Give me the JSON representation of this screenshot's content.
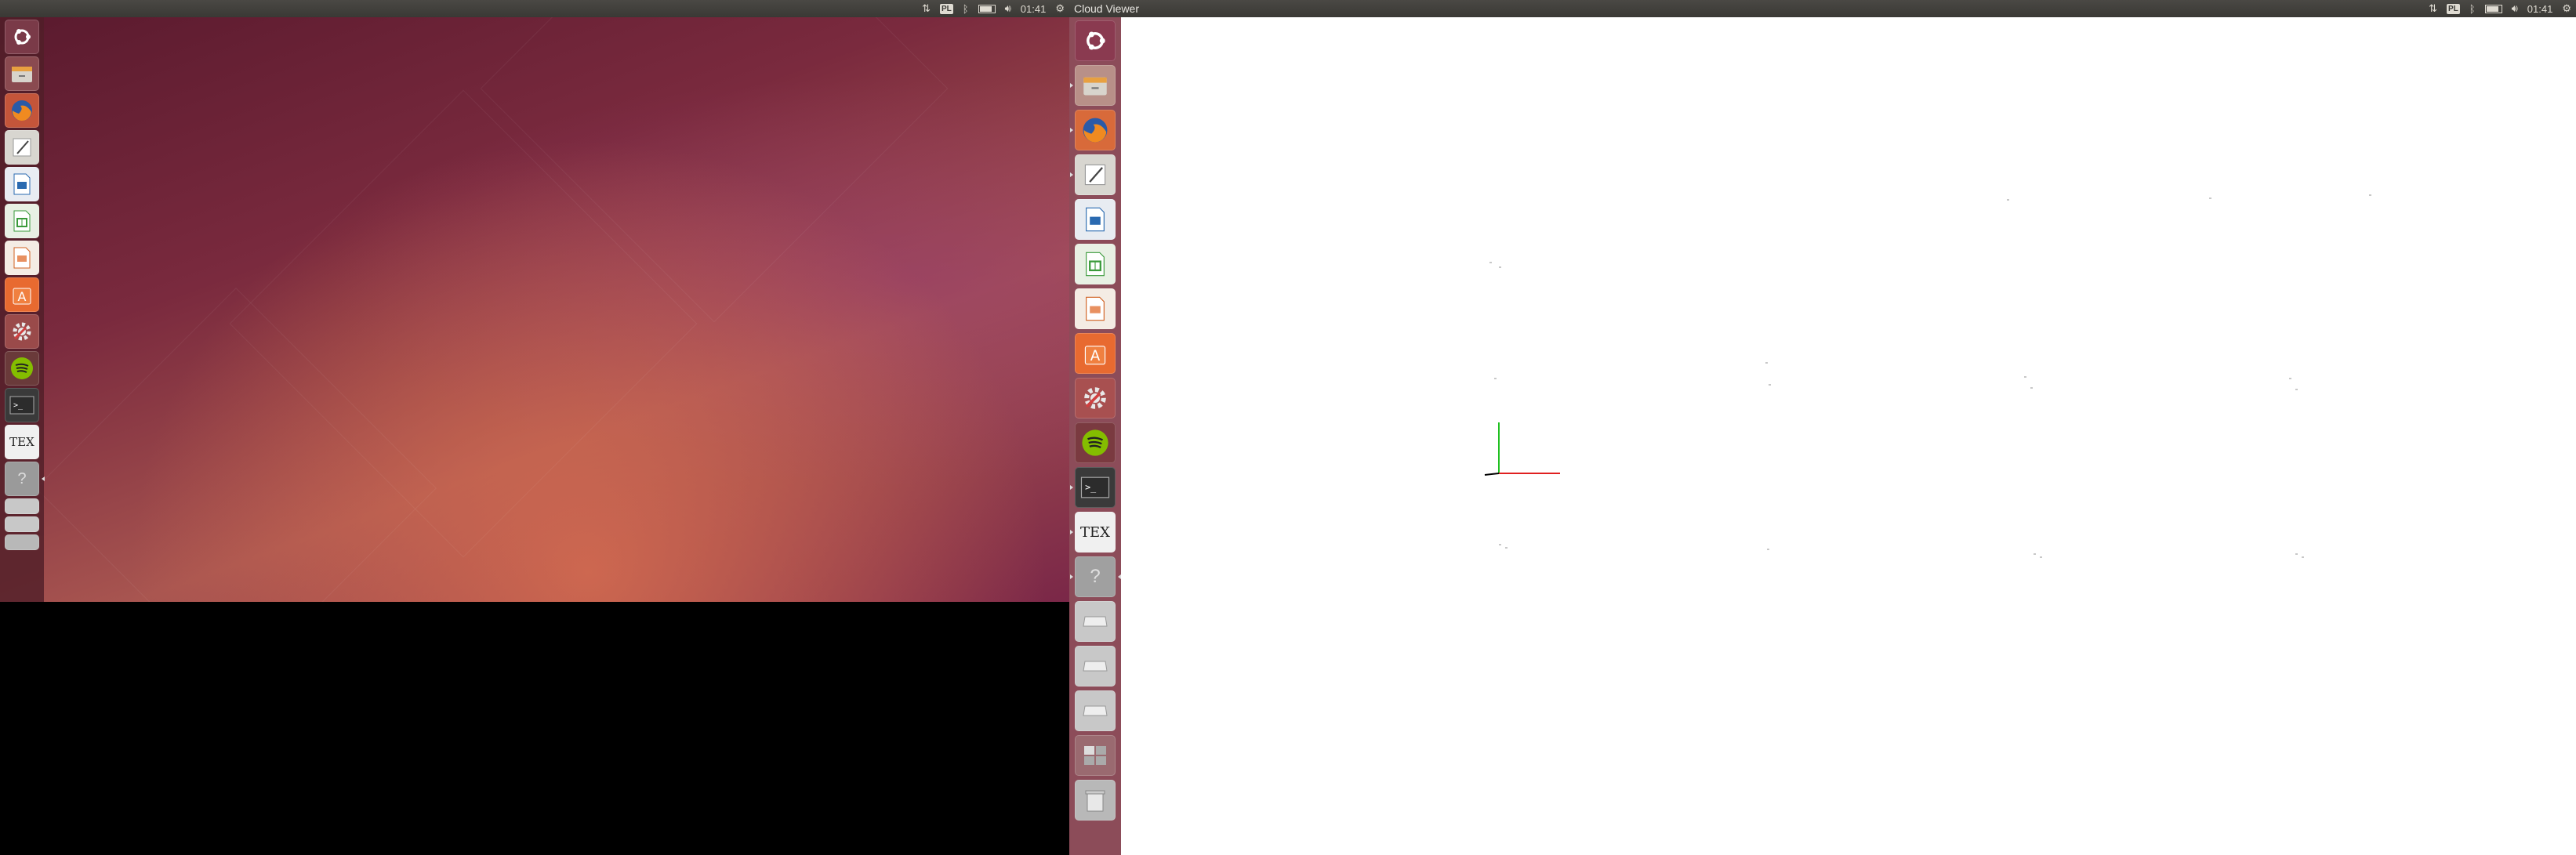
{
  "left_screen": {
    "panel": {
      "keyboard_layout": "PL",
      "clock": "01:41"
    }
  },
  "right_screen": {
    "window_title": "Cloud Viewer",
    "panel": {
      "keyboard_layout": "PL",
      "clock": "01:41"
    }
  },
  "launcher_items": [
    {
      "name": "dash-home",
      "icon": "ubuntu-logo-icon"
    },
    {
      "name": "files",
      "icon": "file-cabinet-icon"
    },
    {
      "name": "firefox",
      "icon": "firefox-icon"
    },
    {
      "name": "text-editor",
      "icon": "text-editor-icon"
    },
    {
      "name": "libreoffice-writer",
      "icon": "writer-document-icon"
    },
    {
      "name": "libreoffice-calc",
      "icon": "calc-spreadsheet-icon"
    },
    {
      "name": "libreoffice-impress",
      "icon": "impress-presentation-icon"
    },
    {
      "name": "software-center",
      "icon": "software-center-icon"
    },
    {
      "name": "system-settings",
      "icon": "gear-wrench-icon"
    },
    {
      "name": "spotify",
      "icon": "spotify-icon"
    },
    {
      "name": "terminal",
      "icon": "terminal-icon"
    },
    {
      "name": "tex-editor",
      "icon": "tex-icon",
      "label": "TEX"
    },
    {
      "name": "unknown-app",
      "icon": "question-icon",
      "label": "?"
    }
  ],
  "colors": {
    "panel": "#3c3b37",
    "launcher": "#5a2330",
    "axis_x": "#e02020",
    "axis_y": "#20c020",
    "axis_z": "#000000"
  }
}
